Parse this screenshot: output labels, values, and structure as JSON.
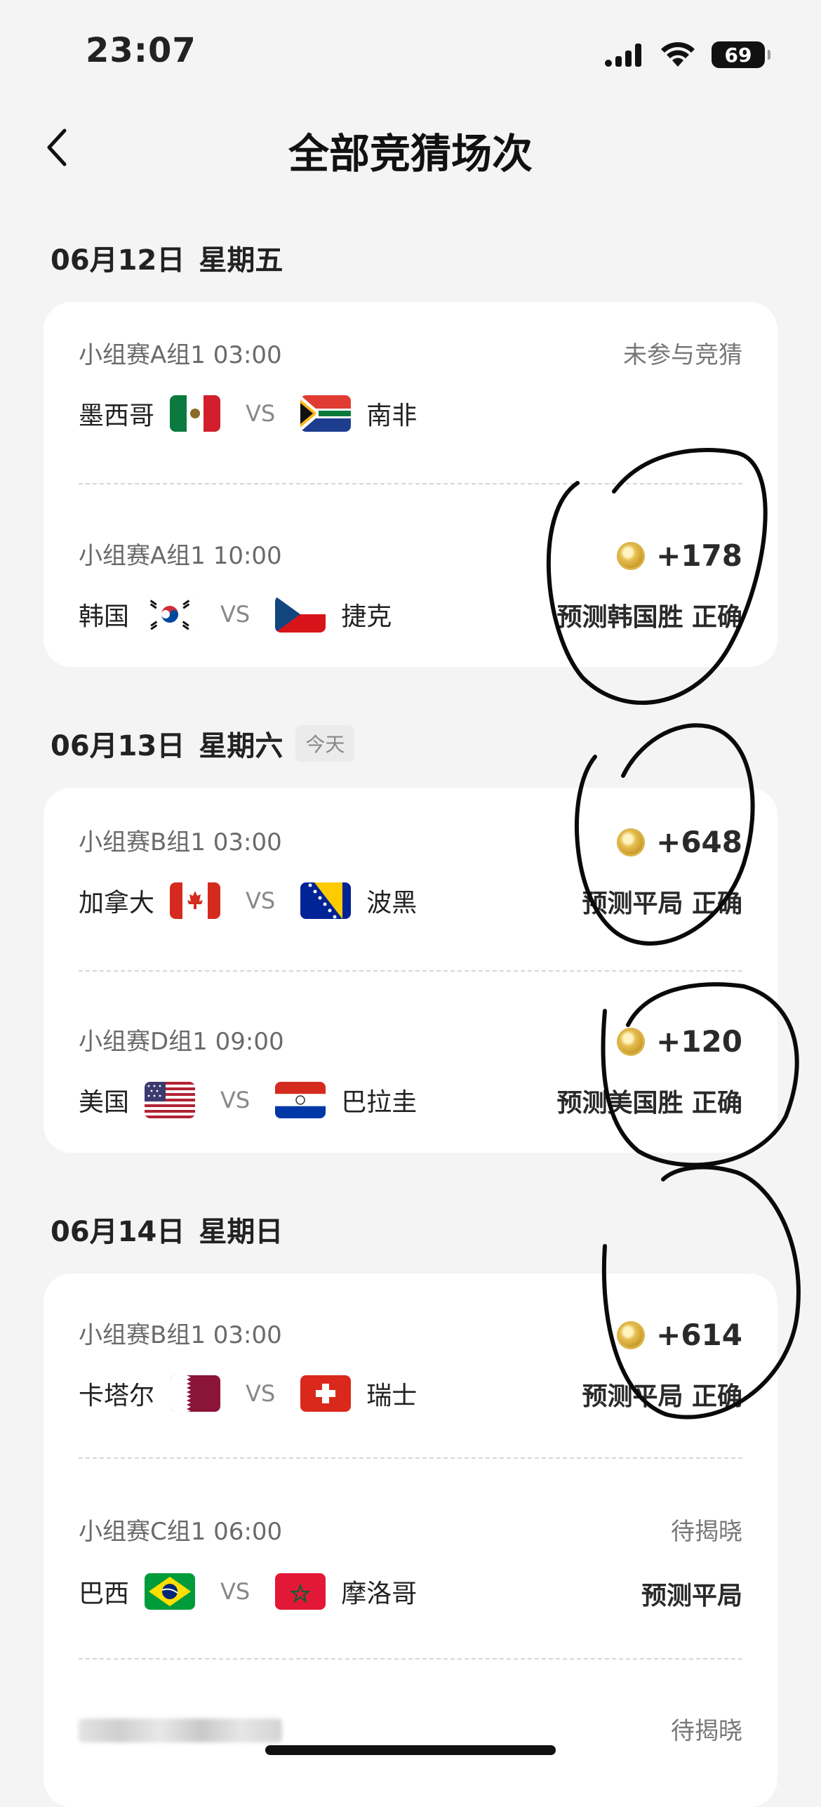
{
  "status_bar": {
    "time": "23:07",
    "battery": "69"
  },
  "nav": {
    "title": "全部竞猜场次"
  },
  "days": [
    {
      "date": "06月12日",
      "weekday": "星期五",
      "matches": [
        {
          "meta": "小组赛A组1 03:00",
          "status": "未参与竞猜",
          "home": "墨西哥",
          "vs": "VS",
          "away": "南非",
          "home_flag": "mexico-flag",
          "away_flag": "south-africa-flag"
        },
        {
          "meta": "小组赛A组1 10:00",
          "reward": "+178",
          "prediction": "预测韩国胜 正确",
          "home": "韩国",
          "vs": "VS",
          "away": "捷克",
          "home_flag": "south-korea-flag",
          "away_flag": "czech-flag"
        }
      ]
    },
    {
      "date": "06月13日",
      "weekday": "星期六",
      "badge": "今天",
      "matches": [
        {
          "meta": "小组赛B组1 03:00",
          "reward": "+648",
          "prediction": "预测平局 正确",
          "home": "加拿大",
          "vs": "VS",
          "away": "波黑",
          "home_flag": "canada-flag",
          "away_flag": "bosnia-flag"
        },
        {
          "meta": "小组赛D组1 09:00",
          "reward": "+120",
          "prediction": "预测美国胜 正确",
          "home": "美国",
          "vs": "VS",
          "away": "巴拉圭",
          "home_flag": "usa-flag",
          "away_flag": "paraguay-flag"
        }
      ]
    },
    {
      "date": "06月14日",
      "weekday": "星期日",
      "matches": [
        {
          "meta": "小组赛B组1 03:00",
          "reward": "+614",
          "prediction": "预测平局 正确",
          "home": "卡塔尔",
          "vs": "VS",
          "away": "瑞士",
          "home_flag": "qatar-flag",
          "away_flag": "switzerland-flag"
        },
        {
          "meta": "小组赛C组1 06:00",
          "status": "待揭晓",
          "prediction": "预测平局",
          "home": "巴西",
          "vs": "VS",
          "away": "摩洛哥",
          "home_flag": "brazil-flag",
          "away_flag": "morocco-flag"
        },
        {
          "status": "待揭晓"
        }
      ]
    }
  ],
  "icons": {
    "back": "chevron-left-icon",
    "coin": "coin-icon",
    "signal": "cellular-signal-icon",
    "wifi": "wifi-icon"
  },
  "colors": {
    "background": "#f4f4f4",
    "card": "#ffffff",
    "annotation_ink": "#0a0a0a",
    "coin_gold": "#c49421"
  }
}
